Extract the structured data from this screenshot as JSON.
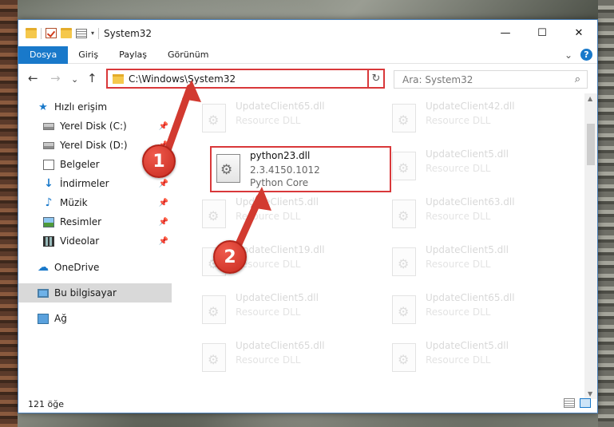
{
  "window": {
    "title": "System32",
    "controls": {
      "minimize": "—",
      "maximize": "☐",
      "close": "✕"
    }
  },
  "ribbon": {
    "tabs": [
      "Dosya",
      "Giriş",
      "Paylaş",
      "Görünüm"
    ],
    "collapse_glyph": "⌄",
    "help_glyph": "?"
  },
  "navigation": {
    "back": "←",
    "forward": "→",
    "recent": "⌄",
    "up": "↑",
    "address": "C:\\Windows\\System32",
    "address_dropdown": "⌄",
    "refresh": "↻",
    "search_placeholder": "Ara: System32",
    "search_glyph": "⌕"
  },
  "sidebar": {
    "quick_access": "Hızlı erişim",
    "items": [
      {
        "label": "Yerel Disk (C:)",
        "pinned": true
      },
      {
        "label": "Yerel Disk (D:)",
        "pinned": true
      },
      {
        "label": "Belgeler",
        "pinned": true
      },
      {
        "label": "İndirmeler",
        "pinned": true
      },
      {
        "label": "Müzik",
        "pinned": true
      },
      {
        "label": "Resimler",
        "pinned": true
      },
      {
        "label": "Videolar",
        "pinned": true
      }
    ],
    "onedrive": "OneDrive",
    "this_pc": "Bu bilgisayar",
    "network": "Ağ",
    "pin_glyph": "📌"
  },
  "files": {
    "left_column": [
      {
        "name": "UpdateClient65.dll",
        "type": "Resource DLL"
      },
      {
        "name": "UpdateClient5.dll",
        "type": "Resource DLL"
      },
      {
        "name": "UpdateClient19.dll",
        "type": "Resource DLL"
      },
      {
        "name": "UpdateClient5.dll",
        "type": "Resource DLL"
      },
      {
        "name": "UpdateClient65.dll",
        "type": "Resource DLL"
      }
    ],
    "right_column": [
      {
        "name": "UpdateClient42.dll",
        "type": "Resource DLL"
      },
      {
        "name": "UpdateClient5.dll",
        "type": "Resource DLL"
      },
      {
        "name": "UpdateClient63.dll",
        "type": "Resource DLL"
      },
      {
        "name": "UpdateClient5.dll",
        "type": "Resource DLL"
      },
      {
        "name": "UpdateClient65.dll",
        "type": "Resource DLL"
      },
      {
        "name": "UpdateClient5.dll",
        "type": "Resource DLL"
      }
    ],
    "featured": {
      "name": "python23.dll",
      "version": "2.3.4150.1012",
      "description": "Python Core"
    }
  },
  "status": {
    "item_count": "121 öğe"
  },
  "annotations": [
    {
      "label": "1"
    },
    {
      "label": "2"
    }
  ],
  "colors": {
    "accent": "#1979ca",
    "highlight": "#d9383a"
  }
}
